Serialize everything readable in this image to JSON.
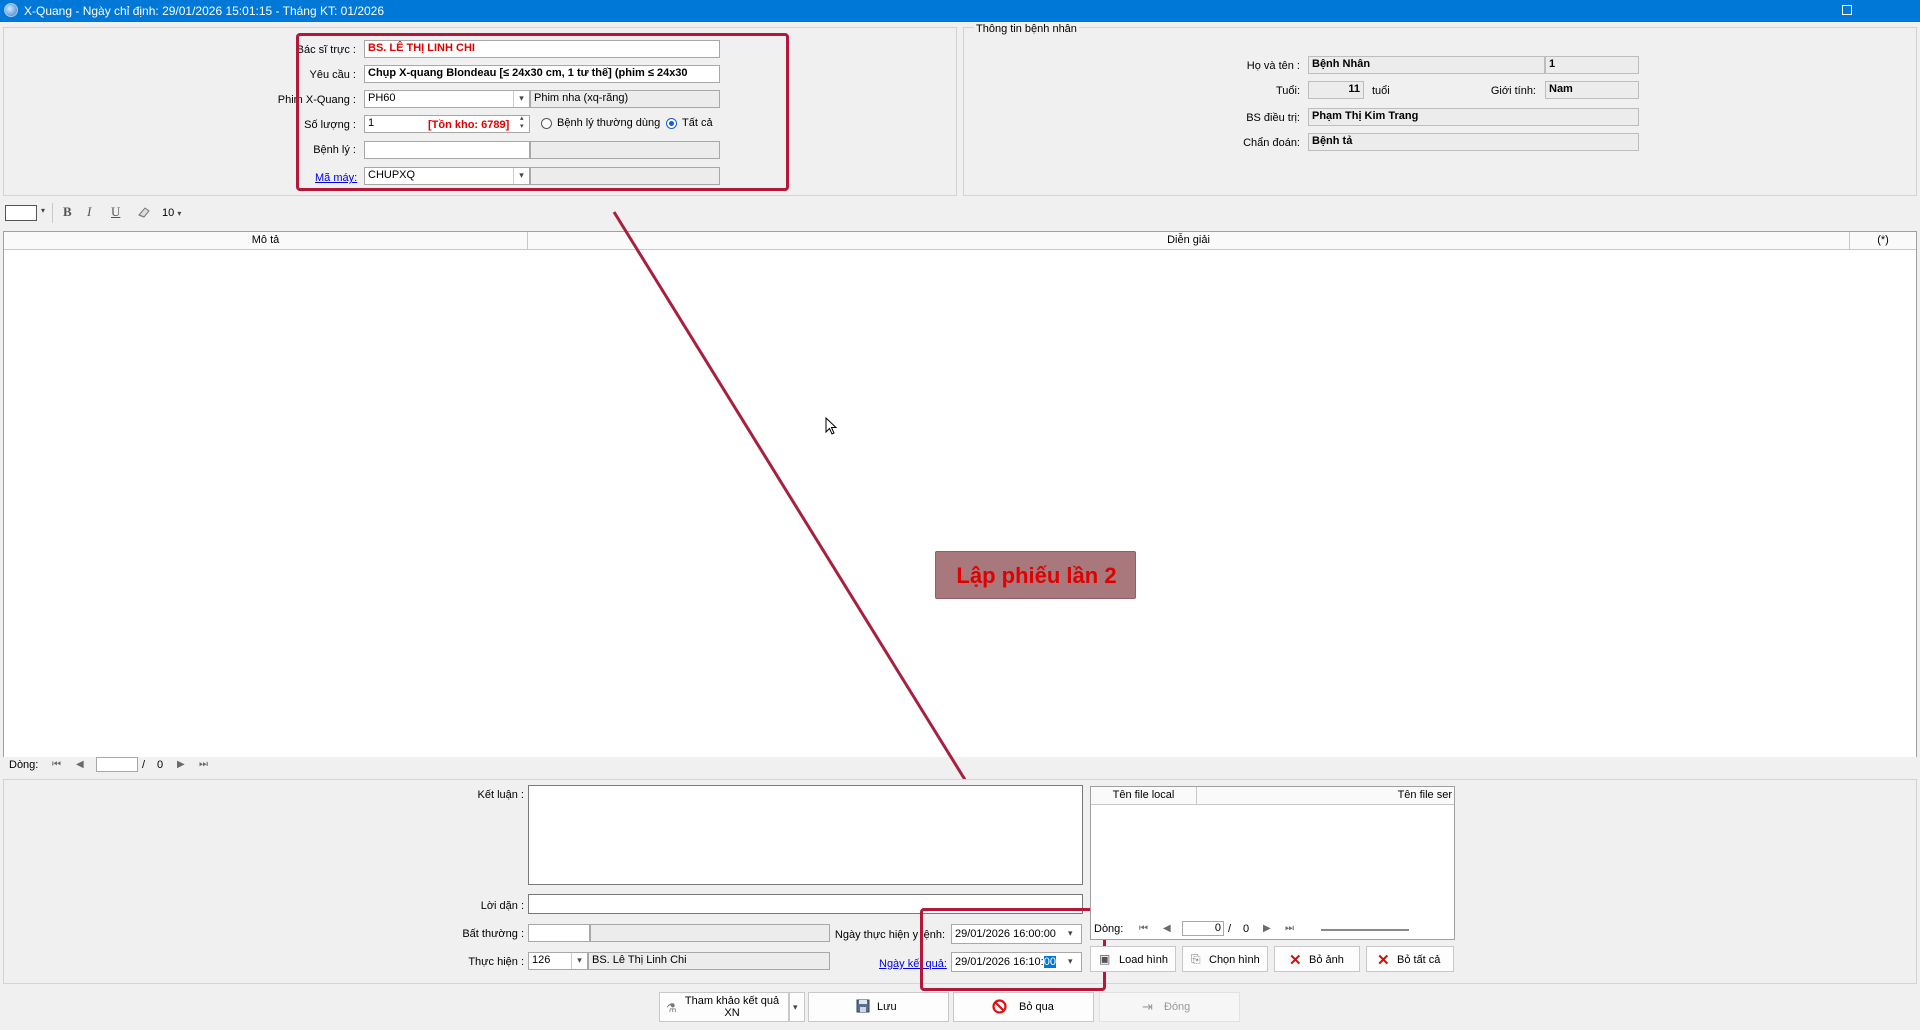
{
  "window": {
    "title": "X-Quang - Ngày chỉ định: 29/01/2026 15:01:15 - Tháng KT: 01/2026"
  },
  "form": {
    "doctor_label": "Bác sĩ trực :",
    "doctor_value": "BS. LÊ THỊ LINH CHI",
    "request_label": "Yêu cầu :",
    "request_value": "Chụp X-quang Blondeau [≤ 24x30 cm, 1 tư thế] (phim  ≤ 24x30",
    "film_label": "Phim X-Quang :",
    "film_code": "PH60",
    "film_name": "Phim nha (xq-răng)",
    "qty_label": "Số lượng :",
    "qty_value": "1",
    "stock_text": "[Tồn kho: 6789]",
    "radio_common": "Bệnh lý thường dùng",
    "radio_all": "Tất cả",
    "disease_label": "Bệnh lý :",
    "machine_label": "Mã máy:",
    "machine_value": "CHUPXQ"
  },
  "patient": {
    "group_title": "Thông tin bệnh nhân",
    "name_label": "Họ và tên :",
    "name_value": "Bệnh Nhân",
    "name_extra": "1",
    "age_label": "Tuổi:",
    "age_value": "11",
    "age_unit": "tuổi",
    "gender_label": "Giới tính:",
    "gender_value": "Nam",
    "treating_label": "BS điều trị:",
    "treating_value": "Phạm Thị Kim Trang",
    "diag_label": "Chẩn đoán:",
    "diag_value": "Bệnh tả"
  },
  "toolbar": {
    "bold": "B",
    "italic": "I",
    "underline": "U",
    "font_size": "10"
  },
  "grid": {
    "columns": [
      "Mô tả",
      "Diễn giải",
      "(*)"
    ],
    "nav_label": "Dòng:",
    "nav_sep": "/",
    "nav_total": "0"
  },
  "annotation": {
    "label": "Lập phiếu lần 2"
  },
  "result": {
    "conclusion_label": "Kết luận :",
    "advice_label": "Lời dặn :",
    "abnormal_label": "Bất thường :",
    "performer_label": "Thực hiện :",
    "performer_code": "126",
    "performer_name": "BS. Lê Thị Linh Chi",
    "exec_date_label": "Ngày thực hiện y lệnh:",
    "exec_date_value": "29/01/2026 16:00:00",
    "result_date_label": "Ngày kết quả:",
    "result_date_value": "29/01/2026 16:10:",
    "result_date_sel": "00"
  },
  "files": {
    "columns": [
      "Tên file local",
      "Tên file ser"
    ],
    "nav_label": "Dòng:",
    "nav_pos": "0",
    "nav_sep": "/",
    "nav_total": "0",
    "load_btn": "Load hình",
    "choose_btn": "Chọn hình",
    "remove_btn": "Bỏ ảnh",
    "remove_all_btn": "Bỏ tất cả"
  },
  "footer": {
    "ref_btn_line1": "Tham khảo kết quả",
    "ref_btn_line2": "XN",
    "save_btn": "Lưu",
    "skip_btn": "Bỏ qua",
    "close_btn": "Đóng"
  },
  "colors": {
    "accent": "#0078d7",
    "callout": "#b5163a",
    "annotation_bg": "#a8787c",
    "annotation_text": "#e00000"
  }
}
